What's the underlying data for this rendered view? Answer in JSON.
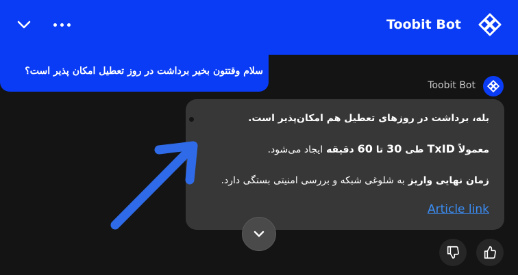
{
  "header": {
    "title": "Toobit Bot",
    "icons": [
      "chevron-down-icon",
      "more-dots-icon",
      "toobit-logo-icon"
    ]
  },
  "conversation": {
    "user_message": "سلام وقتتون بخیر برداشت در روز تعطیل امکان پذیر است؟",
    "bot_name": "Toobit Bot",
    "bot_reply": {
      "line1": "بله، برداشت در روزهای تعطیل هم امکان‌پذیر است.",
      "line2_prefix": "معمولاً",
      "line2_txid": "TxID",
      "line2_mid1": "طی",
      "line2_n1": "30",
      "line2_mid2": "تا",
      "line2_n2": "60",
      "line2_bold_end": "دقیقه",
      "line2_suffix": "ایجاد می‌شود.",
      "line3_bold": "زمان نهایی واریز",
      "line3_rest": "به شلوغی شبکه و بررسی امنیتی بستگی دارد.",
      "link_label": "Article link"
    }
  },
  "colors": {
    "brand_blue": "#0a3cf5",
    "background": "#141414",
    "card": "#373737",
    "link": "#3a8df5",
    "annotation_arrow": "#2f6be8"
  },
  "controls": {
    "scroll_down_icon": "chevron-down-icon",
    "feedback": [
      "thumbs-down-icon",
      "thumbs-up-icon"
    ]
  }
}
